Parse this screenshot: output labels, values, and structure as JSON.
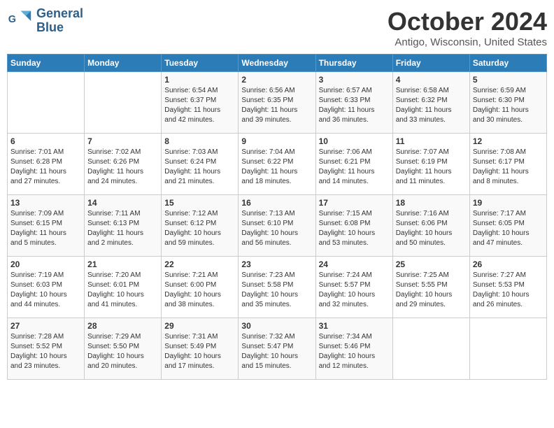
{
  "header": {
    "logo_line1": "General",
    "logo_line2": "Blue",
    "month": "October 2024",
    "location": "Antigo, Wisconsin, United States"
  },
  "days_of_week": [
    "Sunday",
    "Monday",
    "Tuesday",
    "Wednesday",
    "Thursday",
    "Friday",
    "Saturday"
  ],
  "weeks": [
    [
      {
        "day": "",
        "info": ""
      },
      {
        "day": "",
        "info": ""
      },
      {
        "day": "1",
        "info": "Sunrise: 6:54 AM\nSunset: 6:37 PM\nDaylight: 11 hours\nand 42 minutes."
      },
      {
        "day": "2",
        "info": "Sunrise: 6:56 AM\nSunset: 6:35 PM\nDaylight: 11 hours\nand 39 minutes."
      },
      {
        "day": "3",
        "info": "Sunrise: 6:57 AM\nSunset: 6:33 PM\nDaylight: 11 hours\nand 36 minutes."
      },
      {
        "day": "4",
        "info": "Sunrise: 6:58 AM\nSunset: 6:32 PM\nDaylight: 11 hours\nand 33 minutes."
      },
      {
        "day": "5",
        "info": "Sunrise: 6:59 AM\nSunset: 6:30 PM\nDaylight: 11 hours\nand 30 minutes."
      }
    ],
    [
      {
        "day": "6",
        "info": "Sunrise: 7:01 AM\nSunset: 6:28 PM\nDaylight: 11 hours\nand 27 minutes."
      },
      {
        "day": "7",
        "info": "Sunrise: 7:02 AM\nSunset: 6:26 PM\nDaylight: 11 hours\nand 24 minutes."
      },
      {
        "day": "8",
        "info": "Sunrise: 7:03 AM\nSunset: 6:24 PM\nDaylight: 11 hours\nand 21 minutes."
      },
      {
        "day": "9",
        "info": "Sunrise: 7:04 AM\nSunset: 6:22 PM\nDaylight: 11 hours\nand 18 minutes."
      },
      {
        "day": "10",
        "info": "Sunrise: 7:06 AM\nSunset: 6:21 PM\nDaylight: 11 hours\nand 14 minutes."
      },
      {
        "day": "11",
        "info": "Sunrise: 7:07 AM\nSunset: 6:19 PM\nDaylight: 11 hours\nand 11 minutes."
      },
      {
        "day": "12",
        "info": "Sunrise: 7:08 AM\nSunset: 6:17 PM\nDaylight: 11 hours\nand 8 minutes."
      }
    ],
    [
      {
        "day": "13",
        "info": "Sunrise: 7:09 AM\nSunset: 6:15 PM\nDaylight: 11 hours\nand 5 minutes."
      },
      {
        "day": "14",
        "info": "Sunrise: 7:11 AM\nSunset: 6:13 PM\nDaylight: 11 hours\nand 2 minutes."
      },
      {
        "day": "15",
        "info": "Sunrise: 7:12 AM\nSunset: 6:12 PM\nDaylight: 10 hours\nand 59 minutes."
      },
      {
        "day": "16",
        "info": "Sunrise: 7:13 AM\nSunset: 6:10 PM\nDaylight: 10 hours\nand 56 minutes."
      },
      {
        "day": "17",
        "info": "Sunrise: 7:15 AM\nSunset: 6:08 PM\nDaylight: 10 hours\nand 53 minutes."
      },
      {
        "day": "18",
        "info": "Sunrise: 7:16 AM\nSunset: 6:06 PM\nDaylight: 10 hours\nand 50 minutes."
      },
      {
        "day": "19",
        "info": "Sunrise: 7:17 AM\nSunset: 6:05 PM\nDaylight: 10 hours\nand 47 minutes."
      }
    ],
    [
      {
        "day": "20",
        "info": "Sunrise: 7:19 AM\nSunset: 6:03 PM\nDaylight: 10 hours\nand 44 minutes."
      },
      {
        "day": "21",
        "info": "Sunrise: 7:20 AM\nSunset: 6:01 PM\nDaylight: 10 hours\nand 41 minutes."
      },
      {
        "day": "22",
        "info": "Sunrise: 7:21 AM\nSunset: 6:00 PM\nDaylight: 10 hours\nand 38 minutes."
      },
      {
        "day": "23",
        "info": "Sunrise: 7:23 AM\nSunset: 5:58 PM\nDaylight: 10 hours\nand 35 minutes."
      },
      {
        "day": "24",
        "info": "Sunrise: 7:24 AM\nSunset: 5:57 PM\nDaylight: 10 hours\nand 32 minutes."
      },
      {
        "day": "25",
        "info": "Sunrise: 7:25 AM\nSunset: 5:55 PM\nDaylight: 10 hours\nand 29 minutes."
      },
      {
        "day": "26",
        "info": "Sunrise: 7:27 AM\nSunset: 5:53 PM\nDaylight: 10 hours\nand 26 minutes."
      }
    ],
    [
      {
        "day": "27",
        "info": "Sunrise: 7:28 AM\nSunset: 5:52 PM\nDaylight: 10 hours\nand 23 minutes."
      },
      {
        "day": "28",
        "info": "Sunrise: 7:29 AM\nSunset: 5:50 PM\nDaylight: 10 hours\nand 20 minutes."
      },
      {
        "day": "29",
        "info": "Sunrise: 7:31 AM\nSunset: 5:49 PM\nDaylight: 10 hours\nand 17 minutes."
      },
      {
        "day": "30",
        "info": "Sunrise: 7:32 AM\nSunset: 5:47 PM\nDaylight: 10 hours\nand 15 minutes."
      },
      {
        "day": "31",
        "info": "Sunrise: 7:34 AM\nSunset: 5:46 PM\nDaylight: 10 hours\nand 12 minutes."
      },
      {
        "day": "",
        "info": ""
      },
      {
        "day": "",
        "info": ""
      }
    ]
  ]
}
